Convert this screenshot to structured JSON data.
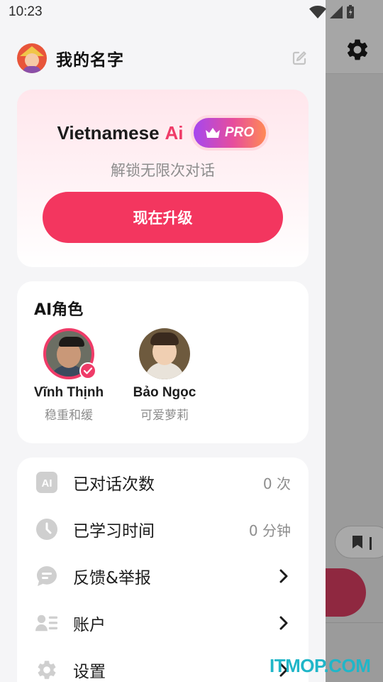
{
  "status_bar": {
    "time": "10:23"
  },
  "profile": {
    "name": "我的名字"
  },
  "pro_card": {
    "title": "Vietnamese",
    "title_accent": "Ai",
    "badge": "PRO",
    "subtitle": "解锁无限次对话",
    "upgrade_label": "现在升级"
  },
  "ai_roles": {
    "title": "AI角色",
    "roles": [
      {
        "name": "Vĩnh Thịnh",
        "desc": "稳重和缓",
        "selected": true
      },
      {
        "name": "Bảo Ngọc",
        "desc": "可爱萝莉",
        "selected": false
      }
    ]
  },
  "menu": {
    "items": [
      {
        "label": "已对话次数",
        "value": "0 次",
        "icon": "ai-icon"
      },
      {
        "label": "已学习时间",
        "value": "0 分钟",
        "icon": "clock-icon"
      },
      {
        "label": "反馈&举报",
        "icon": "feedback-icon"
      },
      {
        "label": "账户",
        "icon": "account-icon"
      },
      {
        "label": "设置",
        "icon": "gear-icon"
      }
    ]
  },
  "watermark": "ITMOP.COM",
  "colors": {
    "accent": "#f3365f",
    "drawer_bg": "#f5f5f7",
    "card_bg": "#ffffff"
  }
}
